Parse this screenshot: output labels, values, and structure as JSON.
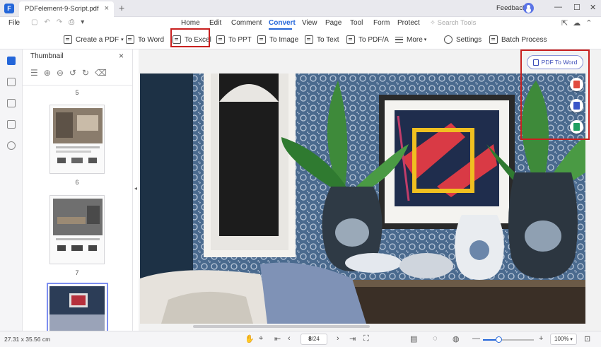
{
  "app": {
    "logo_glyph": "F",
    "tab_title": "PDFelement-9-Script.pdf",
    "tab_close": "×",
    "new_tab": "+",
    "feedback": "Feedback",
    "window_controls": [
      "—",
      "☐",
      "✕"
    ]
  },
  "menu": {
    "file": "File",
    "quick_actions": [
      "undo-icon",
      "redo-icon",
      "print-icon"
    ],
    "items": [
      "Home",
      "Edit",
      "Comment",
      "Convert",
      "View",
      "Page",
      "Tool",
      "Form",
      "Protect"
    ],
    "active": "Convert",
    "search_placeholder": "Search Tools"
  },
  "toolbar": {
    "create_pdf": "Create a PDF",
    "to_word": "To Word",
    "to_excel": "To Excel",
    "to_ppt": "To PPT",
    "to_image": "To Image",
    "to_text": "To Text",
    "to_pdfa": "To PDF/A",
    "more": "More",
    "settings": "Settings",
    "batch": "Batch Process"
  },
  "panel": {
    "title": "Thumbnail",
    "close": "×",
    "page_labels": [
      "5",
      "6",
      "7"
    ]
  },
  "canvas": {
    "pdf_to_word": "PDF To Word",
    "float_colors": [
      "#e04a3f",
      "#3a56c8",
      "#1f9e61"
    ]
  },
  "status": {
    "dimensions": "27.31 x 35.56 cm",
    "current_page": "8",
    "total_pages": "/24",
    "zoom": "100%",
    "zoom_fraction": 0.3
  }
}
